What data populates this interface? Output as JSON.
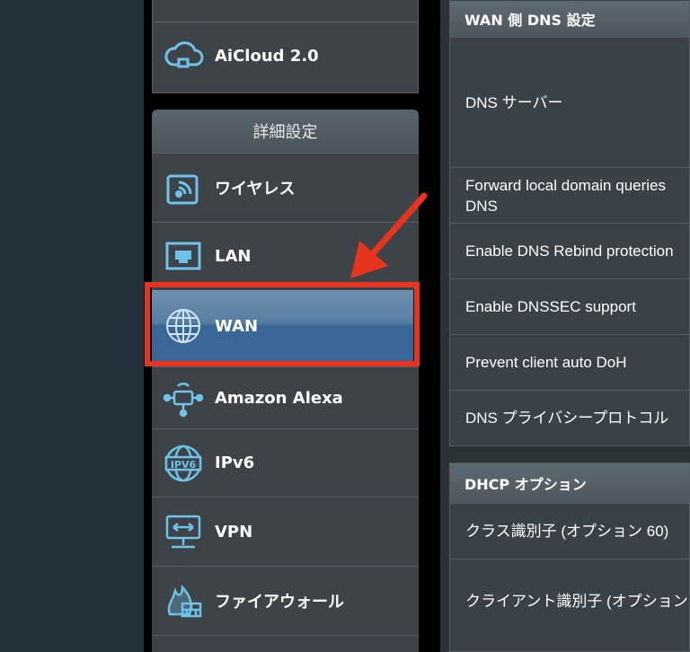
{
  "sidebar": {
    "top_item_label": "AiCloud 2.0",
    "section_header": "詳細設定",
    "items": [
      {
        "label": "ワイヤレス",
        "icon": "wireless-icon"
      },
      {
        "label": "LAN",
        "icon": "lan-icon"
      },
      {
        "label": "WAN",
        "icon": "globe-icon",
        "selected": true
      },
      {
        "label": "Amazon Alexa",
        "icon": "alexa-icon"
      },
      {
        "label": "IPv6",
        "icon": "ipv6-icon"
      },
      {
        "label": "VPN",
        "icon": "vpn-icon"
      },
      {
        "label": "ファイアウォール",
        "icon": "firewall-icon"
      }
    ]
  },
  "dns_table": {
    "header": "WAN 側 DNS 設定",
    "rows": [
      "DNS サーバー",
      "Forward local domain queries",
      "DNS",
      "Enable DNS Rebind protection",
      "Enable DNSSEC support",
      "Prevent client auto DoH",
      "DNS プライバシープロトコル"
    ]
  },
  "dhcp_table": {
    "header": "DHCP オプション",
    "rows": [
      "クラス識別子 (オプション 60)",
      "クライアント識別子 (オプション"
    ]
  },
  "colors": {
    "highlight": "#e8331f",
    "selected": "#3a6797"
  }
}
